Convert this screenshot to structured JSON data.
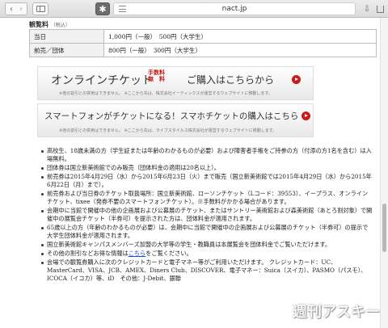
{
  "browser": {
    "url": "nact.jp",
    "icons": [
      "back-icon",
      "forward-icon",
      "sidebar-icon",
      "extension-icon",
      "reader-menu-icon",
      "download-icon",
      "share-icon",
      "tabs-icon"
    ]
  },
  "fees": {
    "heading": "観覧料",
    "heading_note": "（税込）",
    "rows": [
      {
        "label": "当日",
        "value": "1,000円（一般）　500円（大学生）"
      },
      {
        "label": "前売／団体",
        "value": "800円（一般）　300円（大学生）"
      }
    ]
  },
  "banners": {
    "online": {
      "title": "オンラインチケット",
      "badge_line1": "手数料",
      "badge_line2": "無　料",
      "cta": "ご購入はこちらから",
      "note": "※他の割引との併用はできません。 ※ここから先は、株式会社イーティックスが運営するウェブサイトに移動します。"
    },
    "smartphone": {
      "title": "スマートフォンがチケットになる！スマホチケットの購入はこちら",
      "note": "※他の割引との併用はできません。 ※ここから先は、ライブスタイルス株式会社が運営するウェブサイトに移動します。"
    }
  },
  "notes": [
    "高校生、18歳未満の方（学生証または年齢のわかるものが必要）および障害者手帳をご持参の方（付添の方1名を含む）は入場無料。",
    "団体券は国立新美術館でのみ販売（団体料金の適用は20名以上）。",
    "前売券は2015年4月29日（水）から2015年6月23日（火）まで販売（国立新美術館では2015年4月29日（水）から2015年6月22日（月）まで）。",
    "前売券および当日券のチケット取扱場所：国立新美術館、ローソンチケット（Lコード：39553）、イープラス、オンラインチケット、tixee（発券不要のスマートフォンチケット）。※手数料がかかる場合があります。",
    "会期中に当館で開催中の他の企画展および公募展のチケット、またはサントリー美術館および森美術館（あとろ割対象）で開催中の展覧会チケット（半券可）を提示された方は、団体料金が適用されます。",
    "65歳以上の方（年齢のわかるものが必要）は、会期中に当館で開催中の企画展および公募展のチケット（半券可）の提示で大学生団体料金が適用されます。",
    "国立新美術館キャンパスメンバーズ加盟の大学等の学生・教職員は本展覧会を団体料金でご覧いただけます。"
  ],
  "note_link": {
    "before": "その他の割引などお得な情報は",
    "link": "こちら",
    "after": "をご覧ください。"
  },
  "note_last": "会場での観覧券購入に次のクレジットカードと電子マネー等がご利用いただけます。 クレジットカード：UC、MasterCard、VISA、JCB、AMEX、Diners Club、DISCOVER、電子マネー：Suica（スイカ）、PASMO（パスモ）、ICOCA（イコカ）等、iD　その他：J-Debit、銀聯",
  "watermark": "週刊アスキー"
}
